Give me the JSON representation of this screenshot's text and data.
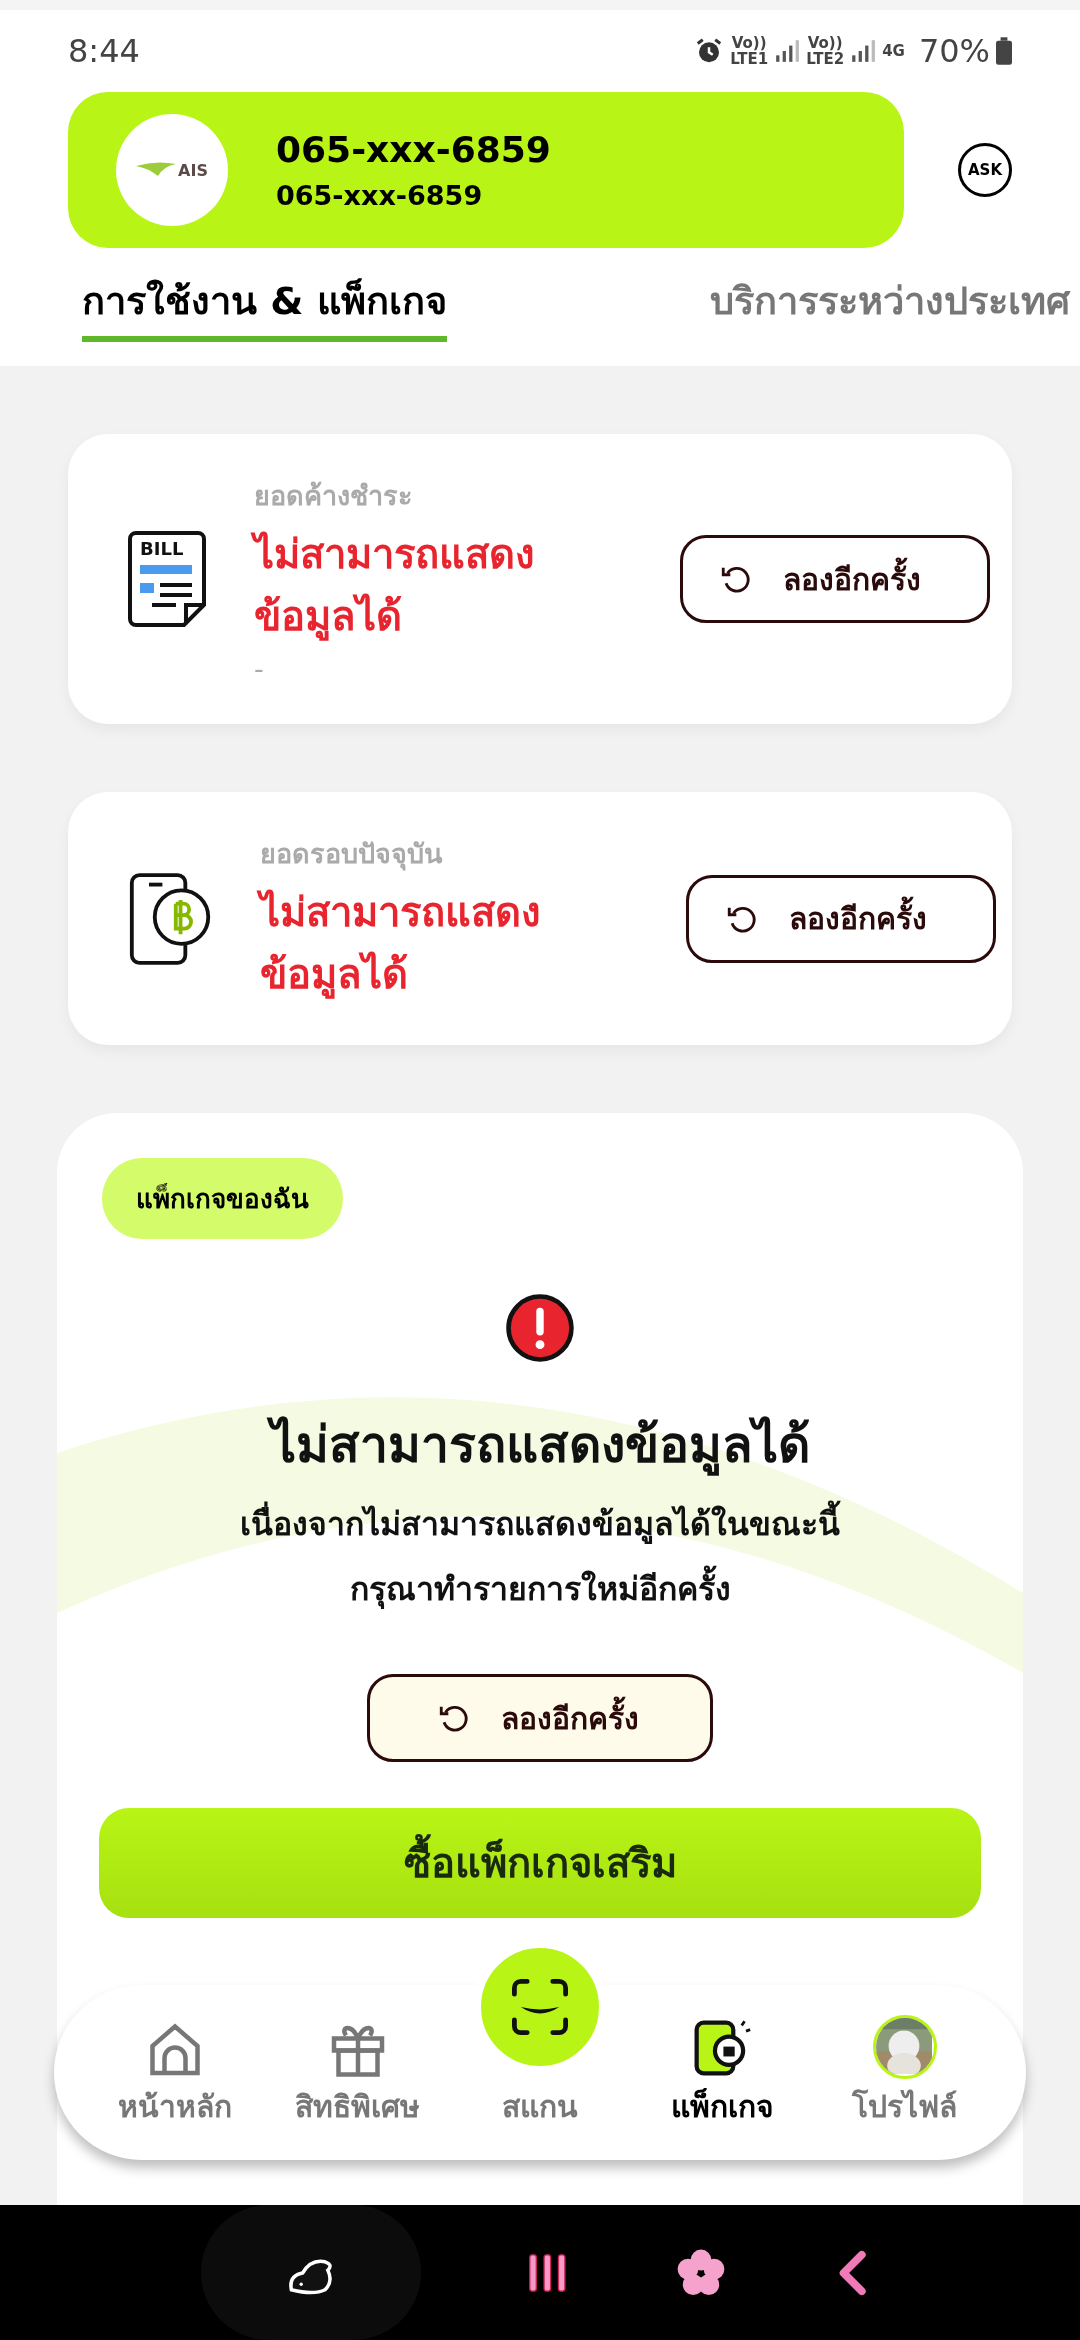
{
  "status_bar": {
    "time": "8:44",
    "sims": [
      {
        "top": "Vo))",
        "bottom": "LTE1"
      },
      {
        "top": "Vo))",
        "bottom": "LTE2"
      }
    ],
    "data_type": "4G",
    "battery": "70%"
  },
  "account": {
    "logo_text": "AIS",
    "number": "065-xxx-6859",
    "subtitle": "065-xxx-6859",
    "ask_label": "ASK"
  },
  "tabs": [
    {
      "label": "การใช้งาน & แพ็กเกจ",
      "selected": true
    },
    {
      "label": "บริการระหว่างประเทศ",
      "selected": false
    }
  ],
  "balances": [
    {
      "kind": "bill",
      "icon_text": "BILL",
      "label": "ยอดค้างชำระ",
      "message": "ไม่สามารถแสดงข้อมูลได้",
      "detail": "-",
      "button": "ลองอีกครั้ง"
    },
    {
      "kind": "phone-baht",
      "label": "ยอดรอบปัจจุบัน",
      "message": "ไม่สามารถแสดงข้อมูลได้",
      "button": "ลองอีกครั้ง"
    }
  ],
  "package": {
    "badge": "แพ็กเกจของฉัน",
    "title": "ไม่สามารถแสดงข้อมูลได้",
    "lines": [
      "เนื่องจากไม่สามารถแสดงข้อมูลได้ในขณะนี้",
      "กรุณาทำรายการใหม่อีกครั้ง"
    ],
    "retry": "ลองอีกครั้ง",
    "buy": "ซื้อแพ็กเกจเสริม"
  },
  "nav": [
    {
      "kind": "home",
      "label": "หน้าหลัก",
      "selected": false
    },
    {
      "kind": "gift",
      "label": "สิทธิพิเศษ",
      "selected": false
    },
    {
      "kind": "scan",
      "label": "สแกน",
      "selected": false
    },
    {
      "kind": "package",
      "label": "แพ็กเกจ",
      "selected": true
    },
    {
      "kind": "profile",
      "label": "โปรไฟล์",
      "selected": false
    }
  ]
}
